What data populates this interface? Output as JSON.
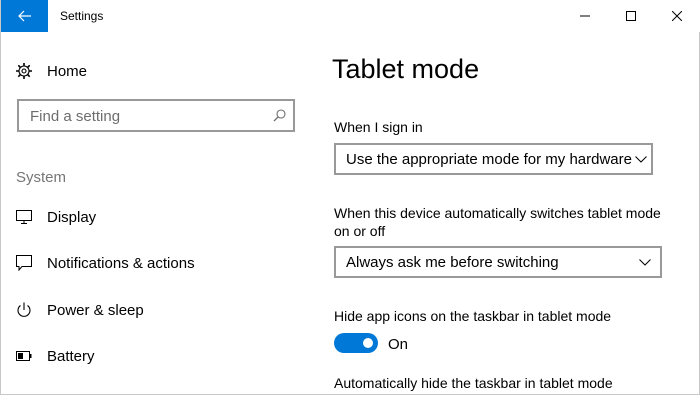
{
  "window": {
    "title": "Settings"
  },
  "sidebar": {
    "home_label": "Home",
    "search_placeholder": "Find a setting",
    "section_label": "System",
    "items": [
      {
        "label": "Display",
        "icon": "monitor-icon"
      },
      {
        "label": "Notifications & actions",
        "icon": "message-icon"
      },
      {
        "label": "Power & sleep",
        "icon": "power-icon"
      },
      {
        "label": "Battery",
        "icon": "battery-icon"
      }
    ]
  },
  "main": {
    "title": "Tablet mode",
    "sign_in_label": "When I sign in",
    "sign_in_value": "Use the appropriate mode for my hardware",
    "switch_label_1": "When this device automatically switches tablet mode",
    "switch_label_2": "on or off",
    "switch_value": "Always ask me before switching",
    "hide_icons_label": "Hide app icons on the taskbar in tablet mode",
    "hide_icons_state": "On",
    "hide_icons_on": true,
    "autohide_label": "Automatically hide the taskbar in tablet mode"
  },
  "colors": {
    "accent": "#0078d7",
    "secondary_text": "#767676",
    "border": "#999999"
  }
}
